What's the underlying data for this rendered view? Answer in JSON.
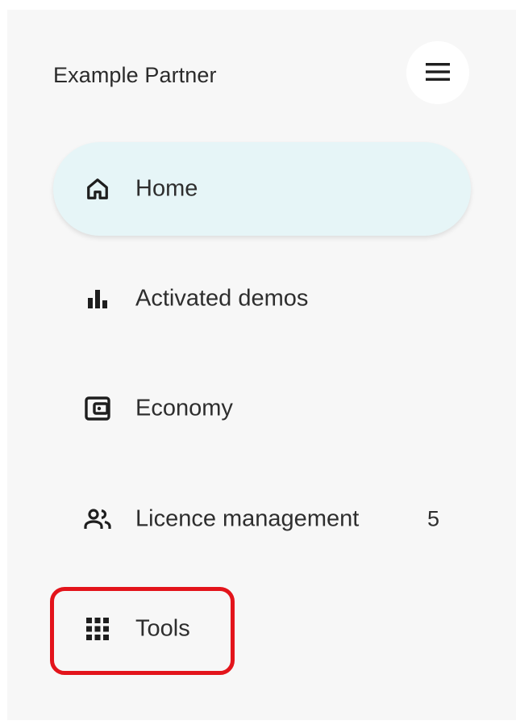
{
  "header": {
    "brand": "Example Partner",
    "menu_icon": "hamburger-menu-icon"
  },
  "nav": {
    "items": [
      {
        "label": "Home",
        "icon": "home-icon",
        "active": true
      },
      {
        "label": "Activated demos",
        "icon": "bar-chart-icon",
        "active": false
      },
      {
        "label": "Economy",
        "icon": "wallet-icon",
        "active": false
      },
      {
        "label": "Licence management",
        "icon": "users-icon",
        "active": false,
        "count": "5"
      },
      {
        "label": "Tools",
        "icon": "apps-grid-icon",
        "active": false
      }
    ]
  },
  "colors": {
    "active_background": "#e6f5f7",
    "panel_background": "#f7f7f7",
    "highlight": "#e3141b"
  }
}
